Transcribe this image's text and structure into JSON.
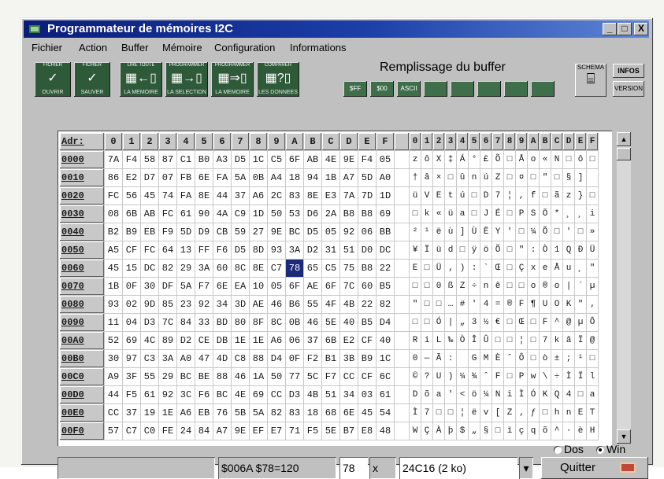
{
  "window": {
    "title": "Programmateur de mémoires I2C",
    "controls": [
      "_",
      "□",
      "X"
    ]
  },
  "menu": [
    "Fichier",
    "Action",
    "Buffer",
    "Mémoire",
    "Configuration",
    "Informations"
  ],
  "toolbar": {
    "buttons": [
      {
        "caption": "FICHIER",
        "label": "OUVRIR",
        "icon": "open-file-icon"
      },
      {
        "caption": "FICHIER",
        "label": "SAUVER",
        "icon": "save-file-icon"
      },
      {
        "caption": "LIRE TOUTE",
        "label": "LA MEMOIRE",
        "icon": "read-memory-icon"
      },
      {
        "caption": "PROGRAMMER",
        "label": "LA SELECTION",
        "icon": "program-selection-icon"
      },
      {
        "caption": "PROGRAMMER",
        "label": "LA MEMOIRE",
        "icon": "program-memory-icon"
      },
      {
        "caption": "COMPARER",
        "label": "LES DONNEES",
        "icon": "compare-data-icon"
      }
    ],
    "fill_title": "Remplissage du buffer",
    "fill_buttons": [
      "$FF",
      "$00",
      "ASCII",
      "",
      "",
      "",
      "",
      ""
    ],
    "side_buttons": [
      "SCHEMA",
      "INFOS",
      "VERSION"
    ]
  },
  "grid": {
    "header_addr": "Adr:",
    "hex_headers": [
      "0",
      "1",
      "2",
      "3",
      "4",
      "5",
      "6",
      "7",
      "8",
      "9",
      "A",
      "B",
      "C",
      "D",
      "E",
      "F"
    ],
    "ascii_headers": [
      "0",
      "1",
      "2",
      "3",
      "4",
      "5",
      "6",
      "7",
      "8",
      "9",
      "A",
      "B",
      "C",
      "D",
      "E",
      "F"
    ],
    "rows": [
      {
        "addr": "0000",
        "hex": [
          "7A",
          "F4",
          "58",
          "87",
          "C1",
          "B0",
          "A3",
          "D5",
          "1C",
          "C5",
          "6F",
          "AB",
          "4E",
          "9E",
          "F4",
          "05"
        ],
        "ascii": [
          "z",
          "ô",
          "X",
          "‡",
          "Á",
          "°",
          "£",
          "Õ",
          "□",
          "Å",
          "o",
          "«",
          "N",
          "□",
          "ô",
          "□"
        ]
      },
      {
        "addr": "0010",
        "hex": [
          "86",
          "E2",
          "D7",
          "07",
          "FB",
          "6E",
          "FA",
          "5A",
          "0B",
          "A4",
          "18",
          "94",
          "1B",
          "A7",
          "5D",
          "A0"
        ],
        "ascii": [
          "†",
          "â",
          "×",
          "□",
          "û",
          "n",
          "ú",
          "Z",
          "□",
          "¤",
          "□",
          "\"",
          "□",
          "§",
          "]",
          ""
        ]
      },
      {
        "addr": "0020",
        "hex": [
          "FC",
          "56",
          "45",
          "74",
          "FA",
          "8E",
          "44",
          "37",
          "A6",
          "2C",
          "83",
          "8E",
          "E3",
          "7A",
          "7D",
          "1D"
        ],
        "ascii": [
          "ü",
          "V",
          "E",
          "t",
          "ú",
          "□",
          "D",
          "7",
          "¦",
          ",",
          "f",
          "□",
          "ã",
          "z",
          "}",
          "□"
        ]
      },
      {
        "addr": "0030",
        "hex": [
          "08",
          "6B",
          "AB",
          "FC",
          "61",
          "90",
          "4A",
          "C9",
          "1D",
          "50",
          "53",
          "D6",
          "2A",
          "B8",
          "B8",
          "69"
        ],
        "ascii": [
          "□",
          "k",
          "«",
          "ü",
          "a",
          "□",
          "J",
          "É",
          "□",
          "P",
          "S",
          "Ö",
          "*",
          "¸",
          "¸",
          "i"
        ]
      },
      {
        "addr": "0040",
        "hex": [
          "B2",
          "B9",
          "EB",
          "F9",
          "5D",
          "D9",
          "CB",
          "59",
          "27",
          "9E",
          "BC",
          "D5",
          "05",
          "92",
          "06",
          "BB"
        ],
        "ascii": [
          "²",
          "¹",
          "ë",
          "ù",
          "]",
          "Ù",
          "Ë",
          "Y",
          "'",
          "□",
          "¼",
          "Õ",
          "□",
          "'",
          "□",
          "»"
        ]
      },
      {
        "addr": "0050",
        "hex": [
          "A5",
          "CF",
          "FC",
          "64",
          "13",
          "FF",
          "F6",
          "D5",
          "8D",
          "93",
          "3A",
          "D2",
          "31",
          "51",
          "D0",
          "DC"
        ],
        "ascii": [
          "¥",
          "Ï",
          "ü",
          "d",
          "□",
          "ÿ",
          "ö",
          "Õ",
          "□",
          "\"",
          ":",
          "Ò",
          "1",
          "Q",
          "Ð",
          "Ü"
        ]
      },
      {
        "addr": "0060",
        "hex": [
          "45",
          "15",
          "DC",
          "82",
          "29",
          "3A",
          "60",
          "8C",
          "8E",
          "C7",
          "78",
          "65",
          "C5",
          "75",
          "B8",
          "22"
        ],
        "ascii": [
          "E",
          "□",
          "Ü",
          "‚",
          ")",
          ":",
          "`",
          "Œ",
          "□",
          "Ç",
          "x",
          "e",
          "Å",
          "u",
          "¸",
          "\""
        ]
      },
      {
        "addr": "0070",
        "hex": [
          "1B",
          "0F",
          "30",
          "DF",
          "5A",
          "F7",
          "6E",
          "EA",
          "10",
          "05",
          "6F",
          "AE",
          "6F",
          "7C",
          "60",
          "B5"
        ],
        "ascii": [
          "□",
          "□",
          "0",
          "ß",
          "Z",
          "÷",
          "n",
          "ê",
          "□",
          "□",
          "o",
          "®",
          "o",
          "|",
          "`",
          "µ"
        ]
      },
      {
        "addr": "0080",
        "hex": [
          "93",
          "02",
          "9D",
          "85",
          "23",
          "92",
          "34",
          "3D",
          "AE",
          "46",
          "B6",
          "55",
          "4F",
          "4B",
          "22",
          "82"
        ],
        "ascii": [
          "\"",
          "□",
          "□",
          "…",
          "#",
          "'",
          "4",
          "=",
          "®",
          "F",
          "¶",
          "U",
          "O",
          "K",
          "\"",
          "‚"
        ]
      },
      {
        "addr": "0090",
        "hex": [
          "11",
          "04",
          "D3",
          "7C",
          "84",
          "33",
          "BD",
          "80",
          "8F",
          "8C",
          "0B",
          "46",
          "5E",
          "40",
          "B5",
          "D4"
        ],
        "ascii": [
          "□",
          "□",
          "Ó",
          "|",
          "„",
          "3",
          "½",
          "€",
          "□",
          "Œ",
          "□",
          "F",
          "^",
          "@",
          "µ",
          "Ô"
        ]
      },
      {
        "addr": "00A0",
        "hex": [
          "52",
          "69",
          "4C",
          "89",
          "D2",
          "CE",
          "DB",
          "1E",
          "1E",
          "A6",
          "06",
          "37",
          "6B",
          "E2",
          "CF",
          "40"
        ],
        "ascii": [
          "R",
          "i",
          "L",
          "‰",
          "Ò",
          "Î",
          "Û",
          "□",
          "□",
          "¦",
          "□",
          "7",
          "k",
          "â",
          "Ï",
          "@"
        ]
      },
      {
        "addr": "00B0",
        "hex": [
          "30",
          "97",
          "C3",
          "3A",
          "A0",
          "47",
          "4D",
          "C8",
          "88",
          "D4",
          "0F",
          "F2",
          "B1",
          "3B",
          "B9",
          "1C"
        ],
        "ascii": [
          "0",
          "—",
          "Ã",
          ":",
          " ",
          "G",
          "M",
          "È",
          "ˆ",
          "Ô",
          "□",
          "ò",
          "±",
          ";",
          "¹",
          "□"
        ]
      },
      {
        "addr": "00C0",
        "hex": [
          "A9",
          "3F",
          "55",
          "29",
          "BC",
          "BE",
          "88",
          "46",
          "1A",
          "50",
          "77",
          "5C",
          "F7",
          "CC",
          "CF",
          "6C"
        ],
        "ascii": [
          "©",
          "?",
          "U",
          ")",
          "¼",
          "¾",
          "ˆ",
          "F",
          "□",
          "P",
          "w",
          "\\",
          "÷",
          "Ì",
          "Ï",
          "l"
        ]
      },
      {
        "addr": "00D0",
        "hex": [
          "44",
          "F5",
          "61",
          "92",
          "3C",
          "F6",
          "BC",
          "4E",
          "69",
          "CC",
          "D3",
          "4B",
          "51",
          "34",
          "03",
          "61"
        ],
        "ascii": [
          "D",
          "õ",
          "a",
          "'",
          "<",
          "ö",
          "¼",
          "N",
          "i",
          "Ì",
          "Ó",
          "K",
          "Q",
          "4",
          "□",
          "a"
        ]
      },
      {
        "addr": "00E0",
        "hex": [
          "CC",
          "37",
          "19",
          "1E",
          "A6",
          "EB",
          "76",
          "5B",
          "5A",
          "82",
          "83",
          "18",
          "68",
          "6E",
          "45",
          "54"
        ],
        "ascii": [
          "Ì",
          "7",
          "□",
          "□",
          "¦",
          "ë",
          "v",
          "[",
          "Z",
          "‚",
          "ƒ",
          "□",
          "h",
          "n",
          "E",
          "T"
        ]
      },
      {
        "addr": "00F0",
        "hex": [
          "57",
          "C7",
          "C0",
          "FE",
          "24",
          "84",
          "A7",
          "9E",
          "EF",
          "E7",
          "71",
          "F5",
          "5E",
          "B7",
          "E8",
          "48"
        ],
        "ascii": [
          "W",
          "Ç",
          "À",
          "þ",
          "$",
          "„",
          "§",
          "□",
          "ï",
          "ç",
          "q",
          "õ",
          "^",
          "·",
          "è",
          "H"
        ]
      }
    ],
    "selected": {
      "row": 6,
      "col": 10
    }
  },
  "display_mode": {
    "options": [
      "Dos",
      "Win"
    ],
    "selected": "Win"
  },
  "status": {
    "address": "$006A  $78=120",
    "value": "78",
    "clear": "x",
    "device": "24C16 (2 ko)"
  },
  "quit_label": "Quitter",
  "colors": {
    "title_bar": "#0a1d7a",
    "toolbar_button": "#2e5a3a",
    "selection": "#1c2a7a",
    "face": "#c0c0c0"
  }
}
